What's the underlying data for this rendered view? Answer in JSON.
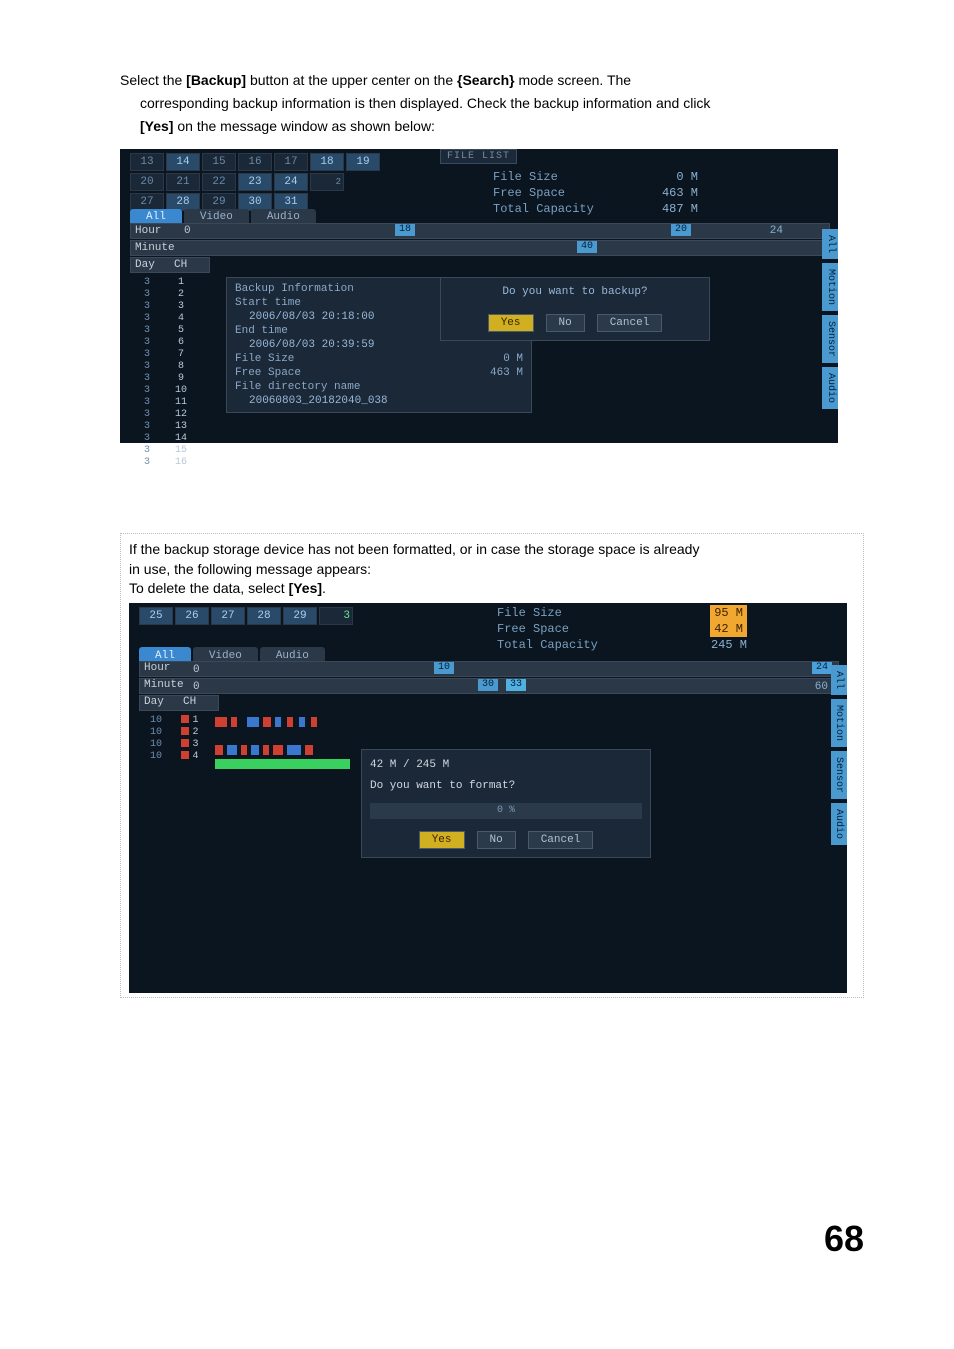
{
  "intro": {
    "line1_pre": "Select the ",
    "line1_b1": "[Backup]",
    "line1_mid": " button at the upper center on the ",
    "line1_b2": "{Search}",
    "line1_post": " mode screen.  The",
    "line2": "corresponding backup information is then displayed. Check the backup information and click",
    "line3_b": "[Yes]",
    "line3_post": " on the message window as shown below:"
  },
  "screen1": {
    "calendar_rows": [
      [
        "13",
        "14",
        "15",
        "16",
        "17",
        "18",
        "19"
      ],
      [
        "20",
        "21",
        "22",
        "23",
        "24",
        "",
        ""
      ],
      [
        "27",
        "28",
        "29",
        "30",
        "31",
        "",
        ""
      ]
    ],
    "calendar_hl": [
      "14",
      "28",
      "23",
      "24",
      "30",
      "31",
      "18",
      "19"
    ],
    "calendar_extra_after_24": "2",
    "file_list": "FILE LIST",
    "file_size_label": "File Size",
    "file_size_val": "0 M",
    "free_space_label": "Free Space",
    "free_space_val": "463 M",
    "total_cap_label": "Total Capacity",
    "total_cap_val": "487 M",
    "tabs": {
      "all": "All",
      "video": "Video",
      "audio": "Audio"
    },
    "hour_label": "Hour",
    "hour_start": "0",
    "hour_tick1": "18",
    "hour_tick2": "20",
    "hour_end": "24",
    "minute_label": "Minute",
    "minute_tick": "40",
    "day_label": "Day",
    "ch_label": "CH",
    "days": [
      "3",
      "3",
      "3",
      "3",
      "3",
      "3",
      "3",
      "3",
      "3",
      "3",
      "3",
      "3",
      "3",
      "3",
      "3",
      "3"
    ],
    "chs": [
      "1",
      "2",
      "3",
      "4",
      "5",
      "6",
      "7",
      "8",
      "9",
      "10",
      "11",
      "12",
      "13",
      "14",
      "15",
      "16"
    ],
    "backup": {
      "title": "Backup Information",
      "start_label": "Start time",
      "start_val": "2006/08/03  20:18:00",
      "end_label": "End time",
      "end_val": "2006/08/03  20:39:59",
      "filesize_label": "File Size",
      "filesize_val": "0 M",
      "freespace_label": "Free Space",
      "freespace_val": "463 M",
      "dir_label": "File directory name",
      "dir_val": "20060803_20182040_038"
    },
    "confirm": {
      "q": "Do you want to backup?",
      "yes": "Yes",
      "no": "No",
      "cancel": "Cancel"
    },
    "side_tabs": [
      "All",
      "Motion",
      "Sensor",
      "Audio"
    ]
  },
  "note": {
    "line1": "If the backup storage device has not been formatted, or in case the storage space is already",
    "line2": "in use, the following message appears:",
    "line3_pre": "To delete the data, select ",
    "line3_b": "[Yes]",
    "line3_post": "."
  },
  "screen2": {
    "calendar_rows": [
      [
        "25",
        "26",
        "27",
        "28",
        "29",
        "3"
      ]
    ],
    "file_size_label": "File Size",
    "file_size_val": "95 M",
    "free_space_label": "Free Space",
    "free_space_val": "42 M",
    "total_cap_label": "Total Capacity",
    "total_cap_val": "245 M",
    "tabs": {
      "all": "All",
      "video": "Video",
      "audio": "Audio"
    },
    "hour_label": "Hour",
    "hour_start": "0",
    "hour_tick1": "10",
    "hour_end": "24",
    "minute_label": "Minute",
    "minute_start": "0",
    "minute_tick1": "30",
    "minute_tick2": "33",
    "minute_end": "60",
    "day_label": "Day",
    "ch_label": "CH",
    "days": [
      "10",
      "10",
      "10",
      "10"
    ],
    "chs": [
      "1",
      "2",
      "3",
      "4"
    ],
    "format": {
      "line1": "42 M / 245 M",
      "q": "Do you want to format?",
      "progress": "0 %",
      "yes": "Yes",
      "no": "No",
      "cancel": "Cancel"
    },
    "side_tabs": [
      "All",
      "Motion",
      "Sensor",
      "Audio"
    ]
  },
  "page_number": "68"
}
